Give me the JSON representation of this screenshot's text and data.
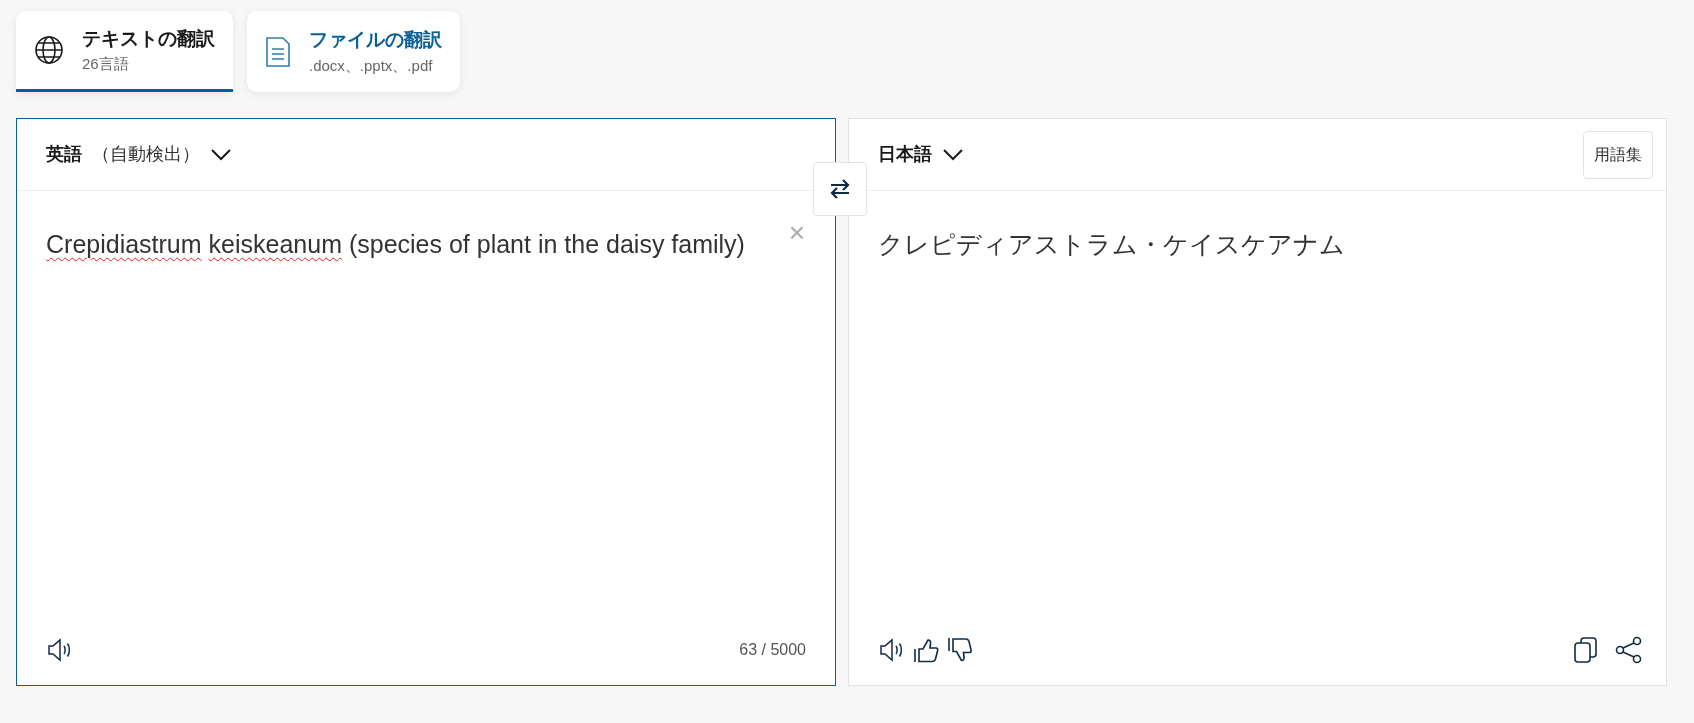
{
  "tabs": [
    {
      "kind": "text",
      "title": "テキストの翻訳",
      "subtitle": "26言語",
      "selected": true
    },
    {
      "kind": "file",
      "title": "ファイルの翻訳",
      "subtitle": ".docx、.pptx、.pdf",
      "selected": false
    }
  ],
  "source": {
    "language": "英語",
    "detected": "（自動検出）",
    "segments": [
      {
        "text": "Crepidiastrum",
        "misspelled": true
      },
      {
        "text": "keiskeanum",
        "misspelled": true
      },
      {
        "text": "(species of plant in the daisy family)",
        "misspelled": false
      }
    ],
    "char_count": "63 / 5000",
    "clear": "×"
  },
  "target": {
    "language": "日本語",
    "glossary_button": "用語集",
    "text": "クレピディアストラム・ケイスケアナム"
  }
}
